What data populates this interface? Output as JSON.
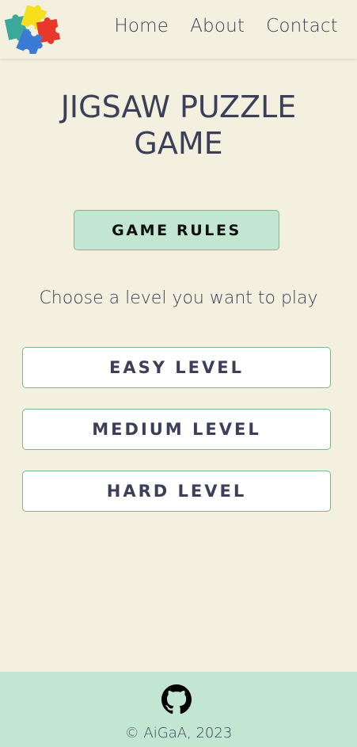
{
  "nav": {
    "items": [
      {
        "label": "Home"
      },
      {
        "label": "About"
      },
      {
        "label": "Contact"
      }
    ]
  },
  "main": {
    "title": "JIGSAW PUZZLE GAME",
    "rules_button": "GAME RULES",
    "choose_text": "Choose a level you want to play",
    "levels": [
      {
        "label": "EASY LEVEL"
      },
      {
        "label": "MEDIUM LEVEL"
      },
      {
        "label": "HARD LEVEL"
      }
    ]
  },
  "footer": {
    "icon": "github-icon",
    "copyright": "© AiGaA, 2023"
  },
  "colors": {
    "background": "#f4f0df",
    "accent": "#c3e6d3",
    "border": "#7bb88e",
    "text": "#3c3f58"
  }
}
